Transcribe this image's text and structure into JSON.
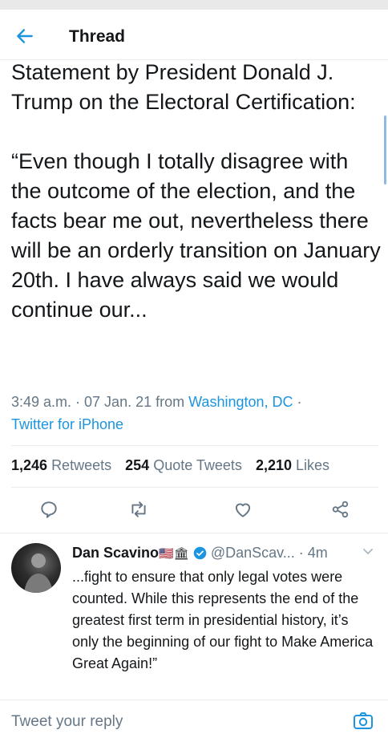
{
  "header": {
    "title": "Thread",
    "back_icon": "arrow-left-icon"
  },
  "tweet": {
    "text": "Statement by President Donald J. Trump on the Electoral Certification:\n\n“Even though I totally disagree with the outcome of the election, and the facts bear me out, nevertheless there will be an orderly transition on January 20th. I have always said we would continue our...",
    "time": "3:49 a.m. · 07 Jan. 21 from ",
    "location": "Washington, DC",
    "location_sep": " ·",
    "client": "Twitter for iPhone"
  },
  "stats": {
    "retweets_count": "1,246",
    "retweets_label": "Retweets",
    "quotes_count": "254",
    "quotes_label": "Quote Tweets",
    "likes_count": "2,210",
    "likes_label": "Likes"
  },
  "actions": [
    "reply-icon",
    "retweet-icon",
    "like-icon",
    "share-icon"
  ],
  "reply": {
    "name": "Dan Scavino",
    "emoji": "🇺🇸🏛",
    "handle": "@DanScav...",
    "time": " · 4m",
    "text": "...fight to ensure that only legal votes were counted. While this represents the end of the greatest first term in presidential history, it’s only the beginning of our fight to Make America Great Again!”"
  },
  "compose": {
    "placeholder": "Tweet your reply"
  },
  "colors": {
    "accent": "#1b95e0",
    "text": "#14171a",
    "secondary": "#657786",
    "divider": "#e6ecf0"
  }
}
